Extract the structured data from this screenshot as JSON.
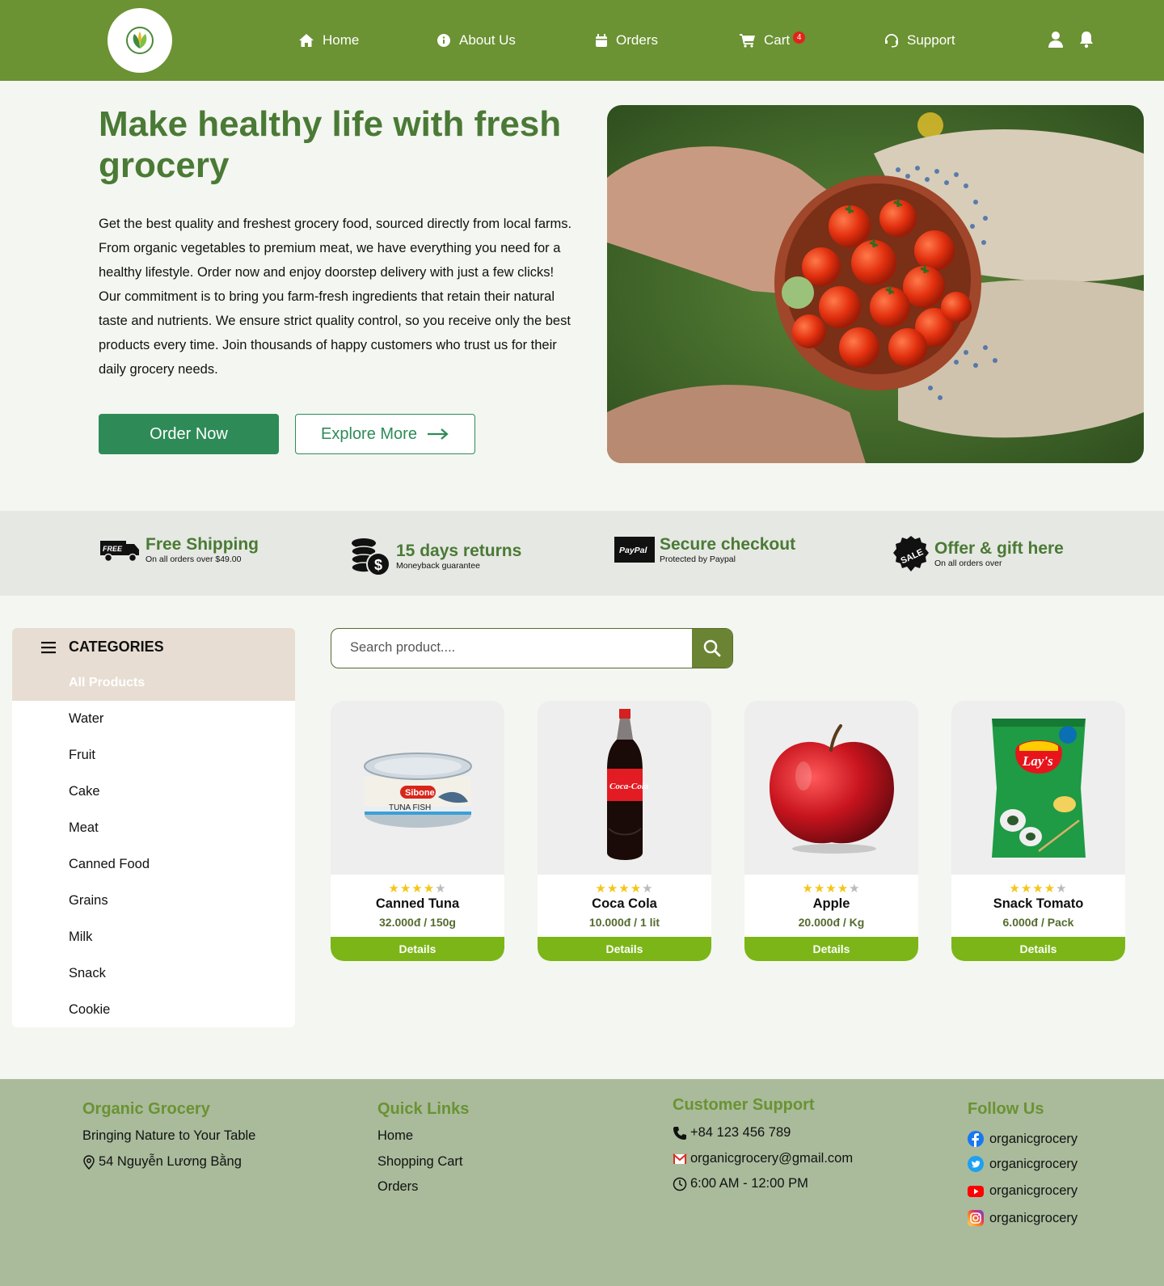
{
  "nav": {
    "home": "Home",
    "about": "About Us",
    "orders": "Orders",
    "cart": "Cart",
    "cart_count": "4",
    "support": "Support"
  },
  "hero": {
    "title": "Make healthy life with fresh grocery",
    "text": "Get the best quality and freshest grocery food, sourced directly from local farms. From organic vegetables to premium meat, we have everything you need for a healthy lifestyle. Order now and enjoy doorstep delivery with just a few clicks! Our commitment is to bring you farm-fresh ingredients that retain their natural taste and nutrients. We ensure strict quality control, so you receive only the best products every time. Join thousands of happy customers who trust us for their daily grocery needs.",
    "order_btn": "Order Now",
    "explore_btn": "Explore More"
  },
  "features": [
    {
      "title": "Free Shipping",
      "sub": "On all orders over $49.00",
      "icon": "free-shipping-truck-icon",
      "icon_text": "FREE"
    },
    {
      "title": "15 days returns",
      "sub": "Moneyback guarantee",
      "icon": "coins-dollar-icon"
    },
    {
      "title": "Secure checkout",
      "sub": "Protected by Paypal",
      "icon": "paypal-icon",
      "icon_text": "PayPal"
    },
    {
      "title": "Offer & gift here",
      "sub": "On all orders over",
      "icon": "sale-badge-icon",
      "icon_text": "SALE"
    }
  ],
  "sidebar": {
    "title": "CATEGORIES",
    "active": "All Products",
    "items": [
      "Water",
      "Fruit",
      "Cake",
      "Meat",
      "Canned Food",
      "Grains",
      "Milk",
      "Snack",
      "Cookie"
    ]
  },
  "search": {
    "placeholder": "Search product...."
  },
  "products": [
    {
      "name": "Canned Tuna",
      "price": "32.000đ / 150g",
      "rating": 4,
      "button": "Details",
      "label_a": "Sibone",
      "label_b": "TUNA FISH"
    },
    {
      "name": "Coca Cola",
      "price": "10.000đ / 1 lit",
      "rating": 4,
      "button": "Details",
      "label_a": "Coca-Cola"
    },
    {
      "name": "Apple",
      "price": "20.000đ / Kg",
      "rating": 4,
      "button": "Details"
    },
    {
      "name": "Snack Tomato",
      "price": "6.000đ / Pack",
      "rating": 4,
      "button": "Details",
      "label_a": "Lay's"
    }
  ],
  "footer": {
    "brand": {
      "title": "Organic Grocery",
      "tagline": "Bringing Nature to Your Table",
      "address": "54 Nguyễn Lương Bằng"
    },
    "links": {
      "title": "Quick Links",
      "items": [
        "Home",
        "Shopping Cart",
        "Orders"
      ]
    },
    "support": {
      "title": "Customer Support",
      "phone": "+84 123 456 789",
      "email": "organicgrocery@gmail.com",
      "hours": "6:00 AM - 12:00 PM"
    },
    "social": {
      "title": "Follow Us",
      "facebook": "organicgrocery",
      "twitter": "organicgrocery",
      "youtube": "organicgrocery",
      "instagram": "organicgrocery"
    }
  },
  "colors": {
    "header": "#6b9233",
    "title_green": "#4a7a35",
    "button_green": "#2e8b57",
    "details_button": "#7cb518",
    "footer_bg": "#a9bb9b",
    "badge_red": "#e2231a"
  }
}
